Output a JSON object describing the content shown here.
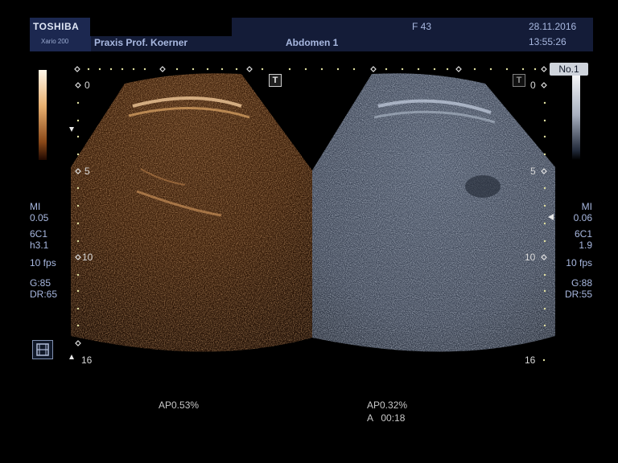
{
  "header": {
    "brand": "TOSHIBA",
    "model": "Xario 200",
    "institution": "Praxis Prof. Koerner",
    "preset": "Abdomen 1",
    "frequency": "F 43",
    "date": "28.11.2016",
    "time": "13:55:26"
  },
  "left_params": [
    "MI",
    "0.05",
    "6C1",
    "h3.1",
    "10 fps",
    "G:85",
    "DR:65"
  ],
  "right_params": [
    "MI",
    "0.06",
    "6C1",
    "1.9",
    "10 fps",
    "G:88",
    "DR:55"
  ],
  "depth_labels": [
    "0",
    "5",
    "10",
    "16"
  ],
  "badge": "No.1",
  "marker_icon": "T",
  "bottom": {
    "left_ap": "AP0.53%",
    "right_ap": "AP0.32%",
    "timer": "A   00:18"
  },
  "icons": {
    "film": "film-icon",
    "marker": "t-marker-icon",
    "focus": "focus-triangle-icon"
  },
  "colors": {
    "contrast_tint": "#c87a3a",
    "bmode_tint": "#8c9cb4",
    "header_bg": "#141c38"
  }
}
